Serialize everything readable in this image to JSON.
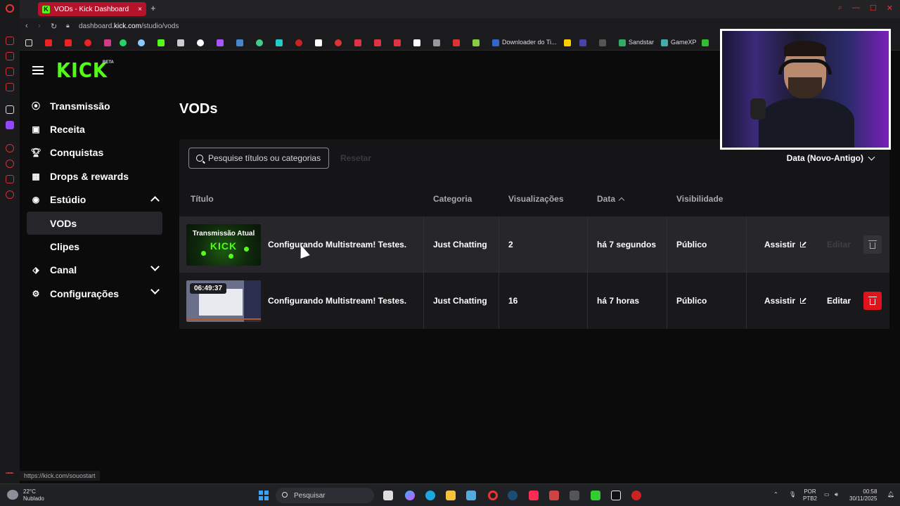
{
  "browser": {
    "tab_title": "VODs - Kick Dashboard",
    "new_tab": "+",
    "url_prefix": "dashboard.",
    "url_domain": "kick.com",
    "url_path": "/studio/vods",
    "bookmarks": [
      "Downloader do Ti...",
      "Sandstar",
      "GameXP"
    ],
    "status_url": "https://kick.com/souostart"
  },
  "logo": {
    "text": "KICK",
    "badge": "BETA"
  },
  "sidebar": {
    "items": [
      {
        "label": "Transmissão",
        "icon": "broadcast-icon"
      },
      {
        "label": "Receita",
        "icon": "revenue-icon"
      },
      {
        "label": "Conquistas",
        "icon": "trophy-icon"
      },
      {
        "label": "Drops & rewards",
        "icon": "drops-icon"
      },
      {
        "label": "Estúdio",
        "icon": "studio-icon"
      },
      {
        "label": "VODs"
      },
      {
        "label": "Clipes"
      },
      {
        "label": "Canal",
        "icon": "channel-icon"
      },
      {
        "label": "Configurações",
        "icon": "gear-icon"
      }
    ]
  },
  "main": {
    "title": "VODs",
    "search_placeholder": "Pesquise títulos ou categorias",
    "reset_label": "Resetar",
    "sort_label": "Data (Novo-Antigo)",
    "columns": [
      "Título",
      "Categoria",
      "Visualizações",
      "Data",
      "Visibilidade"
    ],
    "rows": [
      {
        "thumb_title": "Transmissão Atual",
        "thumb_logo": "KICK",
        "title": "Configurando Multistream! Testes.",
        "category": "Just Chatting",
        "views": "2",
        "date": "há 7 segundos",
        "visibility": "Público",
        "watch": "Assistir",
        "edit": "Editar"
      },
      {
        "duration": "06:49:37",
        "title": "Configurando Multistream! Testes.",
        "category": "Just Chatting",
        "views": "16",
        "date": "há 7 horas",
        "visibility": "Público",
        "watch": "Assistir",
        "edit": "Editar"
      }
    ]
  },
  "taskbar": {
    "temp": "22°C",
    "weather": "Nublado",
    "search": "Pesquisar",
    "lang": "POR",
    "layout": "PTB2",
    "time": "00:58",
    "date": "30/11/2025"
  },
  "colors": {
    "brand": "#53fc18",
    "danger": "#e0131d",
    "tab": "#b5122b"
  }
}
